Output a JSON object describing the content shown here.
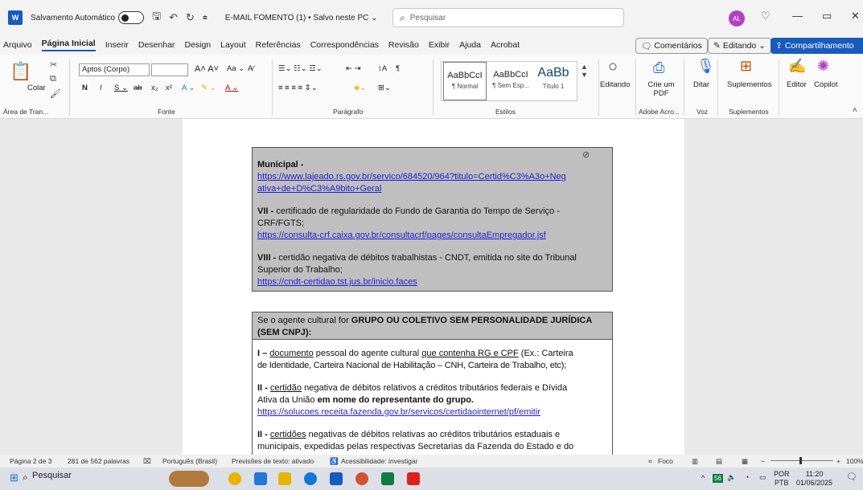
{
  "titlebar": {
    "autosave_label": "Salvamento Automático",
    "doc_title": "E-MAIL FOMENTO (1) • Salvo neste PC ⌄",
    "search_placeholder": "Pesquisar",
    "avatar_initials": "AL"
  },
  "menu": {
    "items": [
      "Arquivo",
      "Página Inicial",
      "Inserir",
      "Desenhar",
      "Design",
      "Layout",
      "Referências",
      "Correspondências",
      "Revisão",
      "Exibir",
      "Ajuda",
      "Acrobat"
    ],
    "comments": "Comentários",
    "editing": "Editando",
    "share": "Compartilhamento"
  },
  "ribbon": {
    "paste_label": "Colar",
    "font_name": "Aptos (Corpo)",
    "font_size": "",
    "styles": [
      {
        "sample": "AaBbCcI",
        "name": "¶ Normal"
      },
      {
        "sample": "AaBbCcI",
        "name": "¶ Sem Esp..."
      },
      {
        "sample": "AaBb",
        "name": "Título 1"
      }
    ],
    "editing_label": "Editando",
    "create_pdf_label": "Crie um PDF",
    "dictate_label": "Ditar",
    "addins_label": "Suplementos",
    "editor_label": "Editor",
    "copilot_label": "Copilot",
    "groups": [
      "Área de Tran...",
      "Fonte",
      "Parágrafo",
      "Estilos",
      "Adobe Acro...",
      "Voz",
      "Suplementos"
    ]
  },
  "document": {
    "sec1": {
      "municipal_label": "Municipal -",
      "municipal_link_1": "https://www.lajeado.rs.gov.br/servico/684520/964?titulo=Certid%C3%A3o+Neg",
      "municipal_link_2": "ativa+de+D%C3%A9bito+Geral",
      "vii_label": "VII -",
      "vii_text_1": " certificado de regularidade do Fundo de Garantia do Tempo de Serviço -",
      "vii_text_2": "CRF/FGTS;",
      "vii_link": "https://consulta-crf.caixa.gov.br/consultacrf/pages/consultaEmpregador.jsf",
      "viii_label": "VIII -",
      "viii_text_1": " certidão negativa de débitos trabalhistas - CNDT, emitida no site do Tribunal",
      "viii_text_2": "Superior do Trabalho;",
      "viii_link": "https://cndt-certidao.tst.jus.br/inicio.faces"
    },
    "sec2": {
      "head_prefix": "Se o agente cultural for ",
      "head_bold_1": "GRUPO OU COLETIVO SEM PERSONALIDADE JURÍDICA",
      "head_bold_2": "(SEM CNPJ):",
      "i_label": "I –",
      "i_word_doc": "documento",
      "i_text_mid": " pessoal do agente cultural ",
      "i_word_rg": "que contenha RG e CPF",
      "i_text_end": " (Ex.: Carteira",
      "i_line2": "de Identidade, Carteira Nacional de Habilitação – CNH, Carteira de Trabalho, etc);",
      "ii_label": "II -",
      "ii_word": "certidão",
      "ii_text_1": " negativa de débitos relativos a créditos tributários federais e Dívida",
      "ii_line2_pre": "Ativa da União ",
      "ii_line2_bold": "em nome do representante do grupo.",
      "ii_link": "https://solucoes.receita.fazenda.gov.br/servicos/certidaointernet/pf/emitir",
      "iii_label": "II -",
      "iii_word": "certidões",
      "iii_text_1": " negativas de débitos relativas ao créditos tributários estaduais e",
      "iii_line2": "municipais, expedidas pelas respectivas Secretarias da Fazenda do Estado e do"
    }
  },
  "status": {
    "page": "Página 2 de 3",
    "words": "281 de 562 palavras",
    "language": "Português (Brasil)",
    "predictions": "Previsões de texto: ativado",
    "accessibility": "Acessibilidade: investigar",
    "focus": "Foco",
    "zoom": "100%"
  },
  "taskbar": {
    "search": "Pesquisar",
    "lang_1": "POR",
    "lang_2": "PTB",
    "time": "11:20",
    "date": "01/06/2025",
    "badge": "56"
  }
}
